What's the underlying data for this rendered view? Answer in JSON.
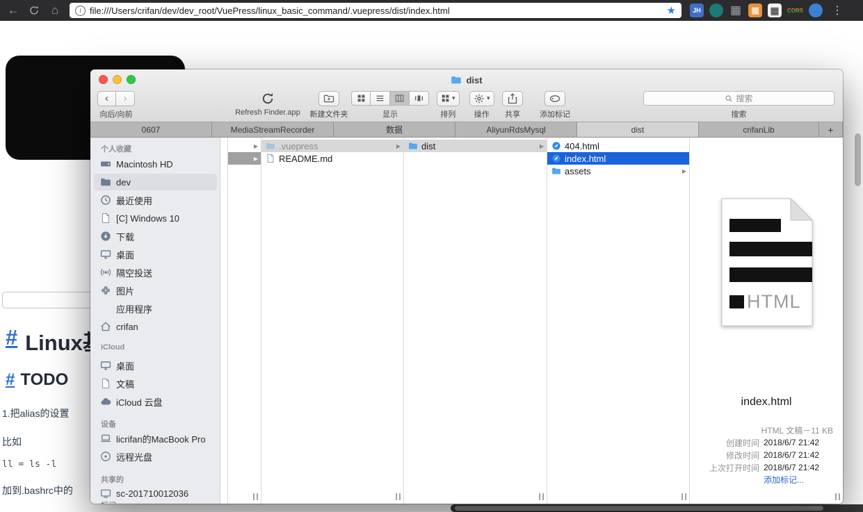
{
  "glyphs": {
    "back": "←",
    "home": "⌂",
    "star": "★",
    "menu": "⋮",
    "info": "i",
    "chev_left": "‹",
    "chev_right": "›",
    "disclosure": "▶",
    "dropdown": "▾",
    "grid_char": "▦",
    "plus": "+"
  },
  "browser": {
    "url": "file:///Users/crifan/dev/dev_root/VuePress/linux_basic_command/.vuepress/dist/index.html",
    "ext1": "JH",
    "ext6": "CORS"
  },
  "page": {
    "h1_anchor": "#",
    "h1_text": "Linux基",
    "h2_anchor": "#",
    "h2_text": "TODO",
    "p1": "1.把alias的设置",
    "p2": "比如",
    "code": "ll = ls -l",
    "p3": "加到.bashrc中的"
  },
  "finder": {
    "title": "dist",
    "toolbar": {
      "back_forward": "向后/向前",
      "refresh": "Refresh Finder.app",
      "new_folder": "新建文件夹",
      "view": "显示",
      "arrange": "排列",
      "action": "操作",
      "share": "共享",
      "tags": "添加标记",
      "search": "搜索",
      "search_placeholder": "搜索"
    },
    "tabs": [
      "0607",
      "MediaStreamRecorder",
      "数据",
      "AliyunRdsMysql",
      "dist",
      "crifanLib"
    ],
    "sidebar": {
      "h1": "个人收藏",
      "fav": [
        "Macintosh HD",
        "dev",
        "最近使用",
        "[C] Windows 10",
        "下载",
        "桌面",
        "隔空投送",
        "图片",
        "应用程序",
        "crifan"
      ],
      "h2": "iCloud",
      "icloud": [
        "桌面",
        "文稿",
        "iCloud 云盘"
      ],
      "h3": "设备",
      "devices": [
        "licrifan的MacBook Pro",
        "远程光盘"
      ],
      "h4": "共享的",
      "shared": [
        "sc-201710012036"
      ],
      "h5": "标记"
    },
    "col2": [
      ".vuepress",
      "README.md"
    ],
    "col3": [
      "dist"
    ],
    "col4": [
      "404.html",
      "index.html",
      "assets"
    ],
    "preview": {
      "icon_label": "HTML",
      "filename": "index.html",
      "kind": "HTML 文稿－11 KB",
      "meta": [
        {
          "label": "创建时间",
          "value": "2018/6/7 21:42"
        },
        {
          "label": "修改时间",
          "value": "2018/6/7 21:42"
        },
        {
          "label": "上次打开时间",
          "value": "2018/6/7 21:42"
        }
      ],
      "add_tags": "添加标记..."
    }
  }
}
